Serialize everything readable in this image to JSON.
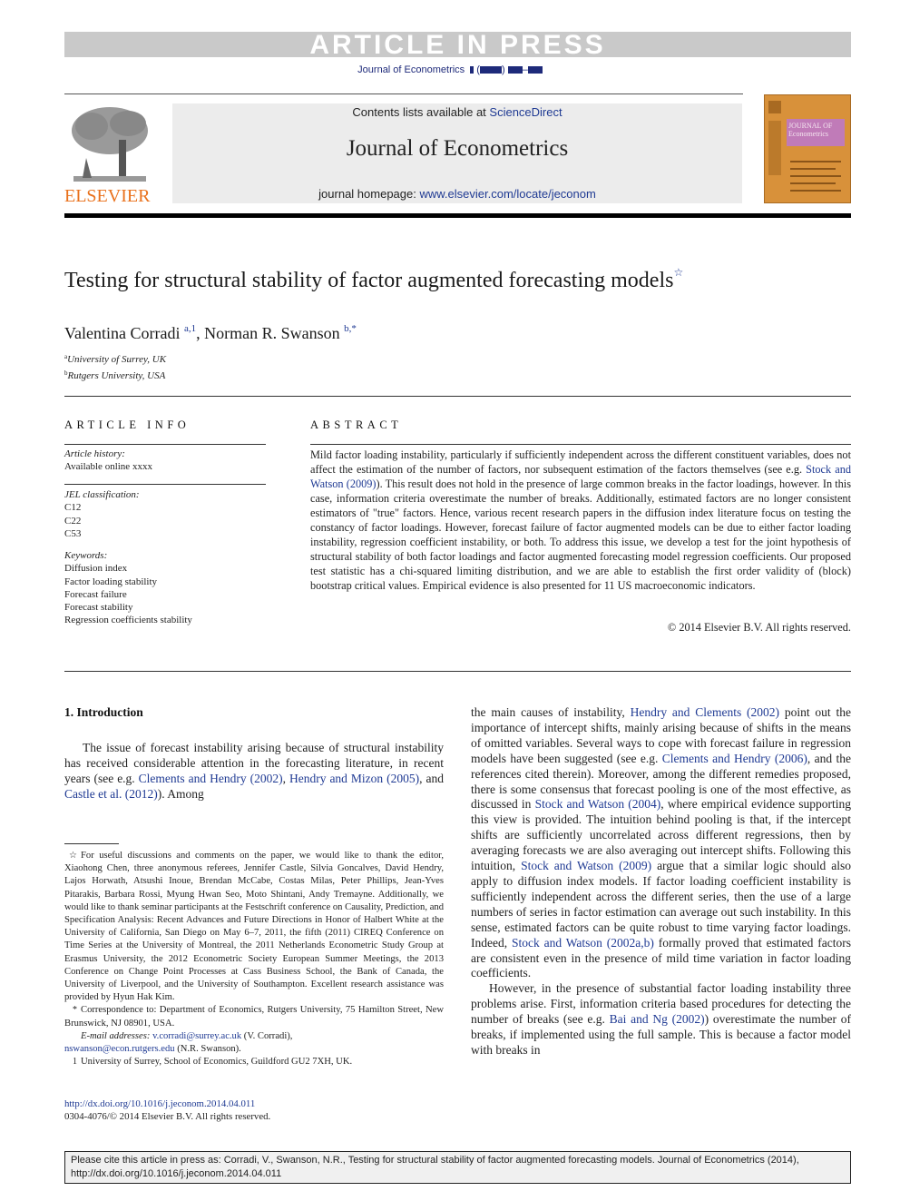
{
  "banner": {
    "press_label": "ARTICLE IN PRESS",
    "journal_ref": "Journal of Econometrics"
  },
  "masthead": {
    "contents_prefix": "Contents lists available at ",
    "contents_link": "ScienceDirect",
    "journal_title": "Journal of Econometrics",
    "homepage_prefix": "journal homepage: ",
    "homepage_link": "www.elsevier.com/locate/jeconom",
    "publisher_logo_text": "ELSEVIER",
    "cover_title": "JOURNAL OF Econometrics"
  },
  "article": {
    "title": "Testing for structural stability of factor augmented forecasting models",
    "title_mark": "☆",
    "authors": [
      {
        "name": "Valentina Corradi",
        "sup": "a,1"
      },
      {
        "name": "Norman R. Swanson",
        "sup": "b,*"
      }
    ],
    "author_sep": ", ",
    "affiliations": [
      {
        "mark": "a",
        "text": "University of Surrey, UK"
      },
      {
        "mark": "b",
        "text": "Rutgers University, USA"
      }
    ]
  },
  "article_info": {
    "heading": "ARTICLE INFO",
    "history_label": "Article history:",
    "history_value": "Available online xxxx",
    "jel_label": "JEL classification:",
    "jel_codes": [
      "C12",
      "C22",
      "C53"
    ],
    "keywords_label": "Keywords:",
    "keywords": [
      "Diffusion index",
      "Factor loading stability",
      "Forecast failure",
      "Forecast stability",
      "Regression coefficients stability"
    ]
  },
  "abstract": {
    "heading": "ABSTRACT",
    "part1": "Mild factor loading instability, particularly if sufficiently independent across the different constituent variables, does not affect the estimation of the number of factors, nor subsequent estimation of the factors themselves (see e.g. ",
    "link1": "Stock and Watson",
    "link1_year": "(2009)",
    "part2": "). This result does not hold in the presence of large common breaks in the factor loadings, however. In this case, information criteria overestimate the number of breaks. Additionally, estimated factors are no longer consistent estimators of \"true\" factors. Hence, various recent research papers in the diffusion index literature focus on testing the constancy of factor loadings. However, forecast failure of factor augmented models can be due to either factor loading instability, regression coefficient instability, or both. To address this issue, we develop a test for the joint hypothesis of structural stability of both factor loadings and factor augmented forecasting model regression coefficients. Our proposed test statistic has a chi-squared limiting distribution, and we are able to establish the first order validity of (block) bootstrap critical values. Empirical evidence is also presented for 11 US macroeconomic indicators.",
    "copyright": "© 2014 Elsevier B.V. All rights reserved."
  },
  "introduction": {
    "heading": "1.  Introduction",
    "left_p1_a": "The issue of forecast instability arising because of structural instability has received considerable attention in the forecasting literature, in recent years (see e.g. ",
    "left_link1": "Clements and Hendry (2002)",
    "left_p1_b": ", ",
    "left_link2": "Hendry and Mizon (2005)",
    "left_p1_c": ", and ",
    "left_link3": "Castle et al. (2012)",
    "left_p1_d": "). Among",
    "right_a": "the main causes of instability, ",
    "right_link1": "Hendry and Clements (2002)",
    "right_b": " point out the importance of intercept shifts, mainly arising because of shifts in the means of omitted variables. Several ways to cope with forecast failure in regression models have been suggested (see e.g. ",
    "right_link2": "Clements and Hendry (2006)",
    "right_c": ", and the references cited therein). Moreover, among the different remedies proposed, there is some consensus that forecast pooling is one of the most effective, as discussed in ",
    "right_link3": "Stock and Watson (2004)",
    "right_d": ", where empirical evidence supporting this view is provided. The intuition behind pooling is that, if the intercept shifts are sufficiently uncorrelated across different regressions, then by averaging forecasts we are also averaging out intercept shifts. Following this intuition, ",
    "right_link4": "Stock and Watson (2009)",
    "right_e": " argue that a similar logic should also apply to diffusion index models. If factor loading coefficient instability is sufficiently independent across the different series, then the use of a large numbers of series in factor estimation can average out such instability. In this sense, estimated factors can be quite robust to time varying factor loadings. Indeed, ",
    "right_link5": "Stock and Watson (2002a,b)",
    "right_f": " formally proved that estimated factors are consistent even in the presence of mild time variation in factor loading coefficients.",
    "right_p2_a": "However, in the presence of substantial factor loading instability three problems arise. First, information criteria based procedures for detecting the number of breaks (see e.g. ",
    "right_link6": "Bai and Ng (2002)",
    "right_p2_b": ") overestimate the number of breaks, if implemented using the full sample. This is because a factor model with breaks in"
  },
  "footnotes": {
    "star_mark": "☆",
    "star_text": "For useful discussions and comments on the paper, we would like to thank the editor, Xiaohong Chen, three anonymous referees, Jennifer Castle, Silvia Goncalves, David Hendry, Lajos Horwath, Atsushi Inoue, Brendan McCabe, Costas Milas, Peter Phillips, Jean-Yves Pitarakis, Barbara Rossi, Myung Hwan Seo, Moto Shintani, Andy Tremayne. Additionally, we would like to thank seminar participants at the Festschrift conference on Causality, Prediction, and Specification Analysis: Recent Advances and Future Directions in Honor of Halbert White at the University of California, San Diego on May 6–7, 2011, the fifth (2011) CIREQ Conference on Time Series at the University of Montreal, the 2011 Netherlands Econometric Study Group at Erasmus University, the 2012 Econometric Society European Summer Meetings, the 2013 Conference on Change Point Processes at Cass Business School, the Bank of Canada, the University of Liverpool, and the University of Southampton. Excellent research assistance was provided by Hyun Hak Kim.",
    "corr_mark": "*",
    "corr_text": "Correspondence to: Department of Economics, Rutgers University, 75 Hamilton Street, New Brunswick, NJ 08901, USA.",
    "email_label": "E-mail addresses: ",
    "email1": "v.corradi@surrey.ac.uk",
    "email1_who": " (V. Corradi),",
    "email2": "nswanson@econ.rutgers.edu",
    "email2_who": " (N.R. Swanson).",
    "one_mark": "1",
    "one_text": "University of Surrey, School of Economics, Guildford GU2 7XH, UK.",
    "doi": "http://dx.doi.org/10.1016/j.jeconom.2014.04.011",
    "issn": "0304-4076/© 2014 Elsevier B.V. All rights reserved."
  },
  "citation_box": {
    "line1": "Please cite this article in press as: Corradi, V., Swanson, N.R., Testing for structural stability of factor augmented forecasting models. Journal of Econometrics (2014),",
    "line2": "http://dx.doi.org/10.1016/j.jeconom.2014.04.011"
  }
}
